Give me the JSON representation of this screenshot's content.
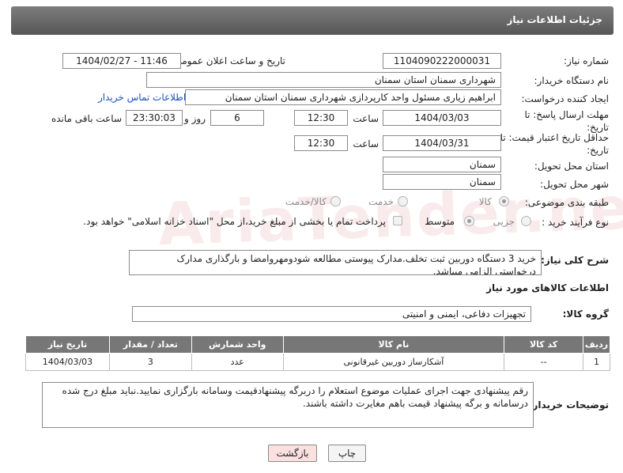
{
  "header": {
    "title": "جزئیات اطلاعات نیاز"
  },
  "fields": {
    "need_number_label": "شماره نیاز:",
    "need_number": "1104090222000031",
    "announce_label": "تاریخ و ساعت اعلان عمومی:",
    "announce_value": "1404/02/27 - 11:46",
    "buyer_org_label": "نام دستگاه خریدار:",
    "buyer_org": "شهرداری سمنان استان سمنان",
    "creator_label": "ایجاد کننده درخواست:",
    "creator": "ابراهیم زیاری مسئول واحد کارپردازی شهرداری سمنان استان سمنان",
    "contact_link": "اطلاعات تماس خریدار",
    "deadline_label": "مهلت ارسال پاسخ: تا تاریخ:",
    "deadline_date": "1404/03/03",
    "time_label": "ساعت",
    "deadline_time": "12:30",
    "days_value": "6",
    "days_label": "روز و",
    "remaining_time": "23:30:03",
    "remaining_label": "ساعت باقی مانده",
    "validity_label": "حداقل تاریخ اعتبار قیمت: تا تاریخ:",
    "validity_date": "1404/03/31",
    "validity_time": "12:30",
    "province_label": "استان محل تحویل:",
    "province": "سمنان",
    "city_label": "شهر محل تحویل:",
    "city": "سمنان",
    "category_label": "طبقه بندی موضوعی:",
    "category_options": [
      "کالا",
      "خدمت",
      "کالا/خدمت"
    ],
    "process_label": "نوع فرآیند خرید :",
    "process_options": [
      "جزیی",
      "متوسط"
    ],
    "payment_note": "پرداخت تمام یا بخشی از مبلغ خرید،از محل \"اسناد خزانه اسلامی\" خواهد بود."
  },
  "description": {
    "label": "شرح کلی نیاز:",
    "text": "خرید 3 دستگاه دوربین ثبت تخلف.مدارک پیوستی مطالعه شودومهروامضا و بارگذاری مدارک درخواستی الزامی میباشد."
  },
  "goods": {
    "section_title": "اطلاعات کالاهای مورد نیاز",
    "group_label": "گروه کالا:",
    "group_value": "تجهیزات دفاعی، ایمنی و امنیتی",
    "columns": [
      "ردیف",
      "کد کالا",
      "نام کالا",
      "واحد شمارش",
      "تعداد / مقدار",
      "تاریخ نیاز"
    ],
    "rows": [
      [
        "1",
        "--",
        "آشکارساز دوربین غیرقانونی",
        "عدد",
        "3",
        "1404/03/03"
      ]
    ]
  },
  "notes": {
    "label": "توضیحات خریدار:",
    "text": "رقم پیشنهادی جهت اجرای عملیات موضوع استعلام را دربرگه پیشنهادقیمت وسامانه بارگزاری نمایید.نباید مبلغ درج شده درسامانه و برگه پیشنهاد قیمت باهم مغایرت داشته باشند."
  },
  "buttons": {
    "print": "چاپ",
    "back": "بازگشت"
  },
  "watermark": "AriaTender.neT",
  "colors": {
    "header": "#6b6b6b",
    "link": "#1a53b8",
    "back_button": "#fbe0e0"
  }
}
